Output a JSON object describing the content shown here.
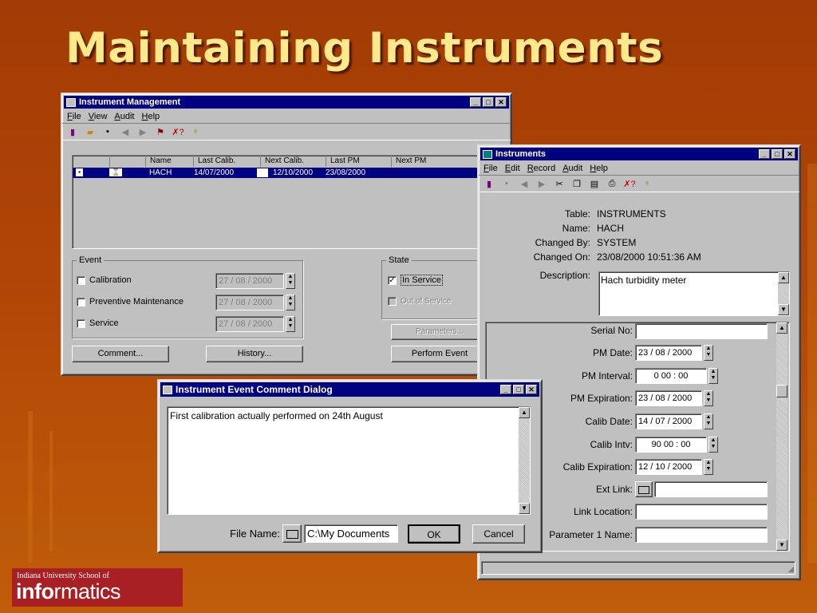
{
  "slide": {
    "title": "Maintaining Instruments"
  },
  "logo": {
    "line1": "Indiana University School of",
    "bold": "info",
    "rest": "rmatics"
  },
  "im": {
    "title": "Instrument Management",
    "menu": [
      "File",
      "View",
      "Audit",
      "Help"
    ],
    "grid": {
      "columns": [
        "Name",
        "Last Calib.",
        "Next Calib.",
        "Last PM",
        "Next PM"
      ],
      "row": {
        "name": "HACH",
        "last_calib": "14/07/2000",
        "next_calib": "12/10/2000",
        "last_pm": "23/08/2000",
        "next_pm": ""
      }
    },
    "event": {
      "label": "Event",
      "items": [
        {
          "label": "Calibration",
          "date": "27 / 08 / 2000"
        },
        {
          "label": "Preventive Maintenance",
          "date": "27 / 08 / 2000"
        },
        {
          "label": "Service",
          "date": "27 / 08 / 2000"
        }
      ]
    },
    "state": {
      "label": "State",
      "in_service": "In Service",
      "out_of_service": "Out of Service"
    },
    "buttons": {
      "parameters": "Parameters...",
      "comment": "Comment...",
      "history": "History...",
      "perform_event": "Perform Event"
    }
  },
  "inst": {
    "title": "Instruments",
    "menu": [
      "File",
      "Edit",
      "Record",
      "Audit",
      "Help"
    ],
    "info": [
      {
        "label": "Table:",
        "value": "INSTRUMENTS"
      },
      {
        "label": "Name:",
        "value": "HACH"
      },
      {
        "label": "Changed By:",
        "value": "SYSTEM"
      },
      {
        "label": "Changed On:",
        "value": "23/08/2000 10:51:36 AM"
      }
    ],
    "description": {
      "label": "Description:",
      "value": "Hach turbidity meter"
    },
    "fields": [
      {
        "label": "Serial No:",
        "value": ""
      },
      {
        "label": "PM Date:",
        "value": "23 / 08 / 2000"
      },
      {
        "label": "PM Interval:",
        "value": "0  00 : 00"
      },
      {
        "label": "PM Expiration:",
        "value": "23 / 08 / 2000"
      },
      {
        "label": "Calib Date:",
        "value": "14 / 07 / 2000"
      },
      {
        "label": "Calib Intv:",
        "value": "90  00 : 00"
      },
      {
        "label": "Calib Expiration:",
        "value": "12 / 10 / 2000"
      },
      {
        "label": "Ext Link:",
        "value": ""
      },
      {
        "label": "Link Location:",
        "value": ""
      },
      {
        "label": "Parameter 1 Name:",
        "value": ""
      }
    ]
  },
  "dlg": {
    "title": "Instrument Event Comment Dialog",
    "comment": "First calibration actually performed on 24th August",
    "file_label": "File Name:",
    "file_value": "C:\\My Documents",
    "ok": "OK",
    "cancel": "Cancel"
  }
}
